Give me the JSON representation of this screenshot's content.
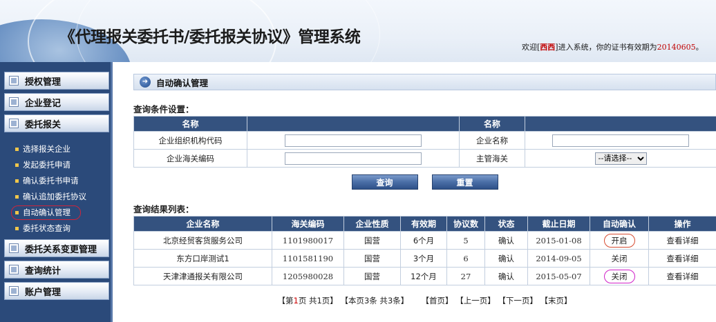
{
  "header": {
    "title": "《代理报关委托书/委托报关协议》管理系统",
    "welcome_pre": "欢迎[",
    "username": "西西",
    "welcome_mid": "]进入系统，你的证书有效期为",
    "cert_date": "20140605",
    "welcome_end": "。"
  },
  "sidebar": {
    "menu1": "授权管理",
    "menu2": "企业登记",
    "menu3": "委托报关",
    "sub": [
      "选择报关企业",
      "发起委托申请",
      "确认委托书申请",
      "确认追加委托协议",
      "自动确认管理",
      "委托状态查询"
    ],
    "menu4": "委托关系变更管理",
    "menu5": "查询统计",
    "menu6": "账户管理"
  },
  "main": {
    "page_title": "自动确认管理",
    "query_label": "查询条件设置：",
    "query_headers": [
      "名称",
      "",
      "名称",
      ""
    ],
    "field_org_code": "企业组织机构代码",
    "field_company_name": "企业名称",
    "field_customs_code": "企业海关编码",
    "field_customs": "主管海关",
    "customs_select": "--请选择--",
    "btn_query": "查询",
    "btn_reset": "重置",
    "result_label": "查询结果列表：",
    "result_headers": [
      "企业名称",
      "海关编码",
      "企业性质",
      "有效期",
      "协议数",
      "状态",
      "截止日期",
      "自动确认",
      "操作"
    ],
    "rows": [
      {
        "name": "北京经贸客货服务公司",
        "code": "1101980017",
        "nature": "国营",
        "period": "6个月",
        "count": "5",
        "status": "确认",
        "deadline": "2015-01-08",
        "auto": "开启",
        "op": "查看详细"
      },
      {
        "name": "东方口岸测试1",
        "code": "1101581190",
        "nature": "国营",
        "period": "3个月",
        "count": "6",
        "status": "确认",
        "deadline": "2014-09-05",
        "auto": "关闭",
        "op": "查看详细"
      },
      {
        "name": "天津津通报关有限公司",
        "code": "1205980028",
        "nature": "国营",
        "period": "12个月",
        "count": "27",
        "status": "确认",
        "deadline": "2015-05-07",
        "auto": "关闭",
        "op": "查看详细"
      }
    ],
    "pager": {
      "p1a": "【第",
      "p1b": "1",
      "p1c": "页 共",
      "p1d": "1",
      "p1e": "页】",
      "p2a": "【本页",
      "p2b": "3",
      "p2c": "条 共",
      "p2d": "3",
      "p2e": "条】",
      "first": "【首页】",
      "prev": "【上一页】",
      "next": "【下一页】",
      "last": "【末页】"
    }
  }
}
